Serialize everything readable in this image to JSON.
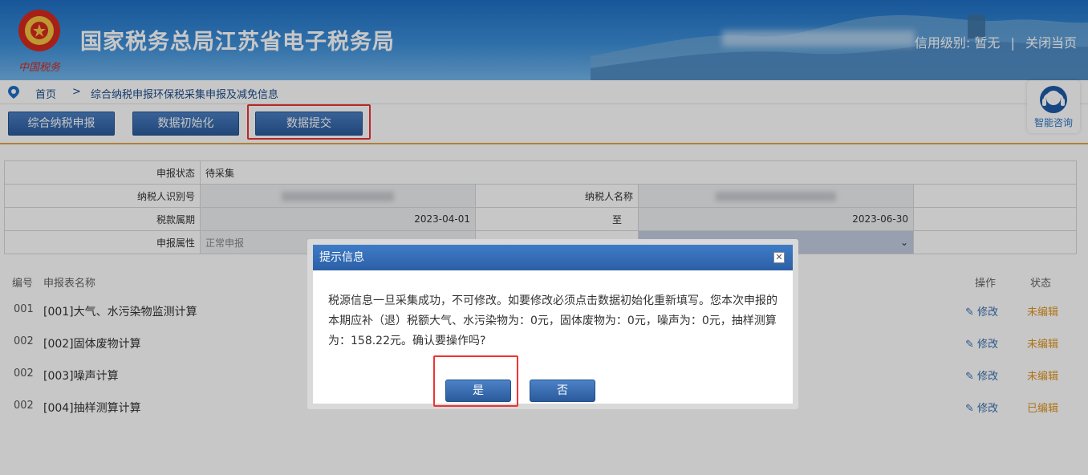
{
  "header": {
    "title": "国家税务总局江苏省电子税务局",
    "emblem_caption": "中国税务",
    "credit_label": "信用级别:",
    "credit_value": "暂无",
    "separator": "|",
    "close_page": "关闭当页"
  },
  "breadcrumb": {
    "home": "首页",
    "separator": ">",
    "current": "综合纳税申报环保税采集申报及减免信息"
  },
  "help": {
    "label": "智能咨询"
  },
  "toolbar": {
    "buttons": [
      "综合纳税申报",
      "数据初始化",
      "数据提交"
    ]
  },
  "info": {
    "status_label": "申报状态",
    "status_value": "待采集",
    "taxpayer_id_label": "纳税人识别号",
    "taxpayer_name_label": "纳税人名称",
    "period_label": "税款属期",
    "period_start": "2023-04-01",
    "period_to": "至",
    "period_end": "2023-06-30",
    "attr_label": "申报属性",
    "attr_value": "正常申报"
  },
  "list": {
    "col_num": "编号",
    "col_name": "申报表名称",
    "col_op": "操作",
    "col_status": "状态",
    "rows": [
      {
        "num": "001",
        "name": "[001]大气、水污染物监测计算",
        "op": "修改",
        "status": "未编辑"
      },
      {
        "num": "002",
        "name": "[002]固体废物计算",
        "op": "修改",
        "status": "未编辑"
      },
      {
        "num": "002",
        "name": "[003]噪声计算",
        "op": "修改",
        "status": "未编辑"
      },
      {
        "num": "002",
        "name": "[004]抽样测算计算",
        "op": "修改",
        "status": "已编辑"
      }
    ]
  },
  "dialog": {
    "title": "提示信息",
    "close": "✕",
    "message": "税源信息一旦采集成功，不可修改。如要修改必须点击数据初始化重新填写。您本次申报的本期应补（退）税额大气、水污染物为：0元，固体废物为：0元，噪声为：0元，抽样测算为：158.22元。确认要操作吗?",
    "yes": "是",
    "no": "否"
  },
  "colors": {
    "header_blue": "#2a76c8",
    "button_blue": "#2c5b9b",
    "status_orange": "#e0941e",
    "highlight_red": "#e33333"
  }
}
